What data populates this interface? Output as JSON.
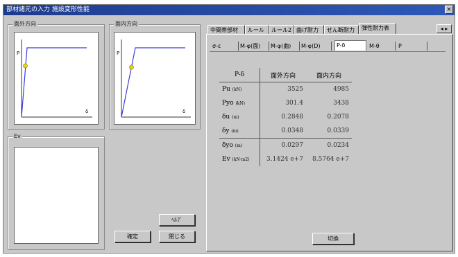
{
  "window": {
    "title": "部材諸元の入力 施設変形性能",
    "close_glyph": "×"
  },
  "left_panel": {
    "group_out_title": "面外方向",
    "group_in_title": "面内方向",
    "group_ev_title": "Ev",
    "plot_out": {
      "y_label": "P",
      "x_label": "δ"
    },
    "plot_in": {
      "y_label": "P",
      "x_label": "δ"
    }
  },
  "buttons": {
    "help": "ﾍﾙﾌﾟ",
    "confirm": "確定",
    "close": "閉じる",
    "ok": "切換"
  },
  "tabs": [
    "中間帯部材",
    "ルール",
    "ルール2",
    "曲げ耐力",
    "せん断耐力",
    "弾性耐力表"
  ],
  "active_tab_index": 5,
  "scroll_glyph": "◂ ▸",
  "subtabs": [
    "σ-ε",
    "M-φ(面)",
    "M-φ(曲)",
    "M-φ(D)",
    "P-δ",
    "M-θ",
    "P"
  ],
  "active_subtab_index": 4,
  "table": {
    "header": [
      "P-δ",
      "面外方向",
      "面内方向"
    ],
    "rows": [
      {
        "label": "Pu",
        "unit": "(kN)",
        "out": "3525",
        "in": "4985"
      },
      {
        "label": "Pyo",
        "unit": "(kN)",
        "out": "301.4",
        "in": "3438"
      },
      {
        "label": "δu",
        "unit": "(m)",
        "out": "0.2848",
        "in": "0.2078"
      },
      {
        "label": "δy",
        "unit": "(m)",
        "out": "0.0348",
        "in": "0.0339"
      },
      {
        "label": "δyo",
        "unit": "(m)",
        "out": "0.0297",
        "in": "0.0234"
      },
      {
        "label": "Ev",
        "unit": "(kN·m2)",
        "out": "3.1424 e+7",
        "in": "8.5764 e+7"
      }
    ]
  },
  "colors": {
    "curve": "#3b3bdb",
    "marker": "#e6d21a",
    "face": "#c8c8c8"
  }
}
